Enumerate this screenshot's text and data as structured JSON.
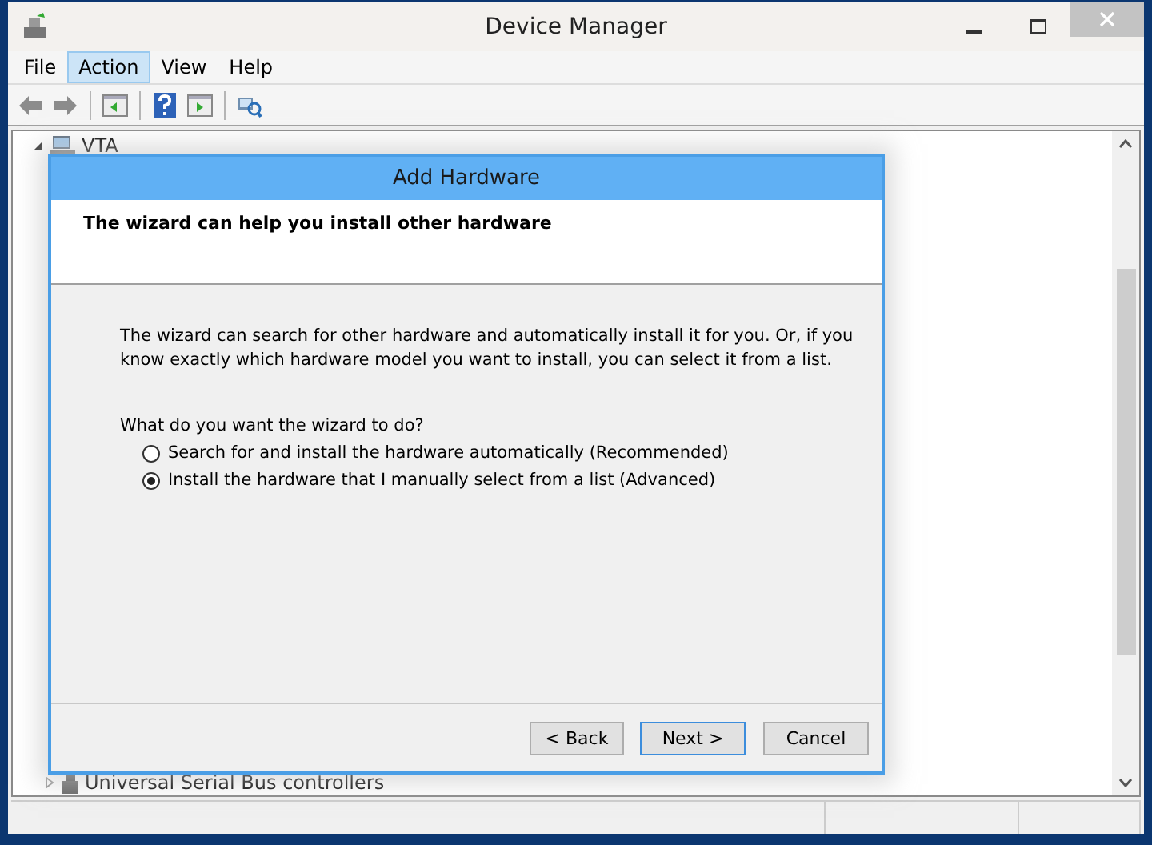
{
  "window": {
    "title": "Device Manager"
  },
  "menu": [
    {
      "label": "File",
      "selected": false
    },
    {
      "label": "Action",
      "selected": true
    },
    {
      "label": "View",
      "selected": false
    },
    {
      "label": "Help",
      "selected": false
    }
  ],
  "tree": [
    {
      "label": "VTA",
      "expanded": true,
      "children": [
        {
          "label": "Universal Serial Bus controllers",
          "expanded": false
        }
      ]
    }
  ],
  "dialog": {
    "title": "Add Hardware",
    "heading": "The wizard can help you install other hardware",
    "description": "The wizard can search for other hardware and automatically install it for you. Or, if you know exactly which hardware model you want to install, you can select it from a list.",
    "question": "What do you want the wizard to do?",
    "options": [
      {
        "label": "Search for and install the hardware automatically (Recommended)",
        "selected": false
      },
      {
        "label": "Install the hardware that I manually select from a list (Advanced)",
        "selected": true
      }
    ],
    "buttons": [
      {
        "label": "< Back",
        "default": false
      },
      {
        "label": "Next >",
        "default": true
      },
      {
        "label": "Cancel",
        "default": false
      }
    ]
  }
}
